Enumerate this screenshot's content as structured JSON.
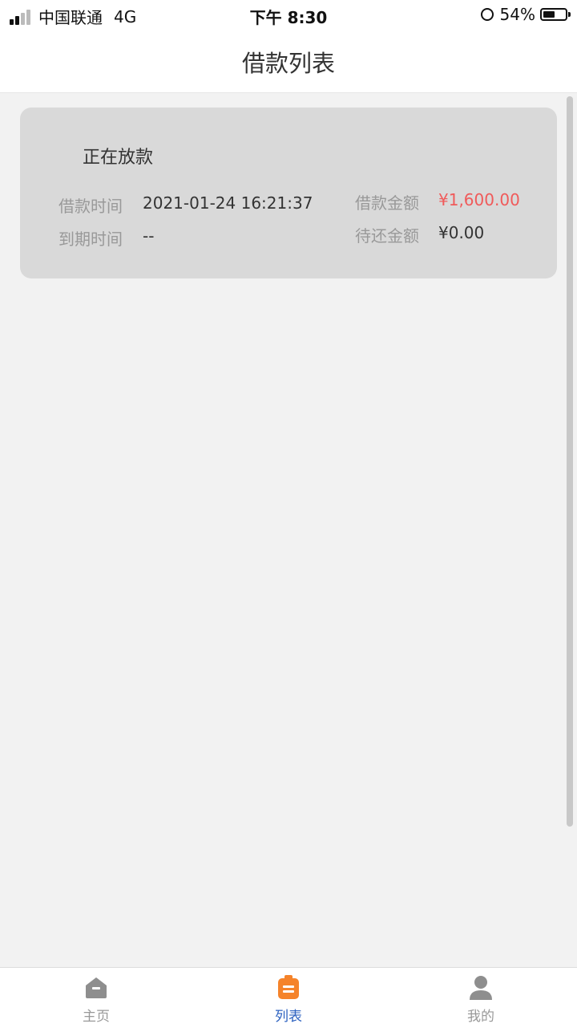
{
  "status_bar": {
    "carrier": "中国联通",
    "network": "4G",
    "time": "下午 8:30",
    "battery_text": "54%",
    "battery_level": 0.54
  },
  "nav": {
    "title": "借款列表"
  },
  "loan": {
    "status": "正在放款",
    "loan_time_label": "借款时间",
    "loan_time_value": "2021-01-24 16:21:37",
    "due_time_label": "到期时间",
    "due_time_value": "--",
    "amount_label": "借款金额",
    "amount_value": "¥1,600.00",
    "remaining_label": "待还金额",
    "remaining_value": "¥0.00",
    "amount_color": "#f05a5a"
  },
  "tabs": [
    {
      "label": "主页",
      "icon": "home-icon"
    },
    {
      "label": "列表",
      "icon": "list-icon",
      "active": true,
      "color": "#f5832a"
    },
    {
      "label": "我的",
      "icon": "profile-icon"
    }
  ]
}
